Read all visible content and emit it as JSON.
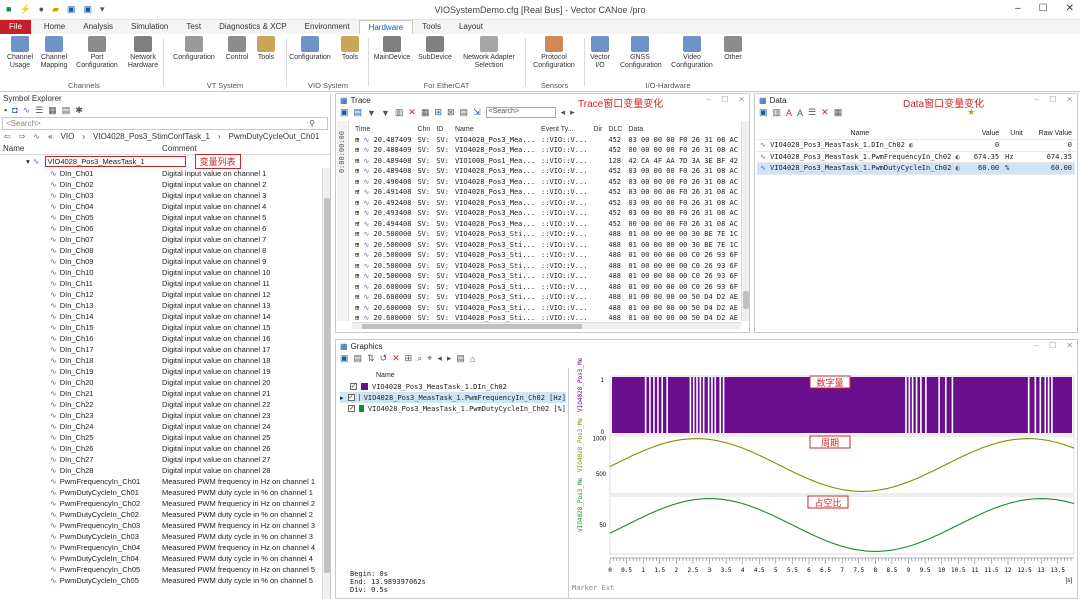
{
  "title_bar": {
    "title": "VIOSystemDemo.cfg [Real Bus] - Vector CANoe /pro"
  },
  "tabs": [
    "File",
    "Home",
    "Analysis",
    "Simulation",
    "Test",
    "Diagnostics & XCP",
    "Environment",
    "Hardware",
    "Tools",
    "Layout"
  ],
  "active_tab": "Hardware",
  "ribbon": {
    "buttons": [
      {
        "label": "Channel\nUsage",
        "icon": "channel-usage-icon"
      },
      {
        "label": "Channel\nMapping",
        "icon": "channel-mapping-icon"
      },
      {
        "label": "Port\nConfiguration",
        "icon": "port-icon"
      },
      {
        "label": "Network\nHardware",
        "icon": "network-hardware-icon"
      },
      {
        "label": "Configuration",
        "icon": "vt-config-icon"
      },
      {
        "label": "Control",
        "icon": "control-icon"
      },
      {
        "label": "Tools",
        "icon": "vt-tools-icon"
      },
      {
        "label": "Configuration",
        "icon": "vio-config-icon"
      },
      {
        "label": "Tools",
        "icon": "vio-tools-icon"
      },
      {
        "label": "MainDevice",
        "icon": "main-device-icon"
      },
      {
        "label": "SubDevice",
        "icon": "sub-device-icon"
      },
      {
        "label": "Network Adapter\nSelection",
        "icon": "network-adapter-icon"
      },
      {
        "label": "Protocol\nConfiguration",
        "icon": "protocol-icon"
      },
      {
        "label": "Vector\nI/O",
        "icon": "vector-io-icon"
      },
      {
        "label": "GNSS\nConfiguration",
        "icon": "gnss-icon"
      },
      {
        "label": "Video\nConfiguration",
        "icon": "video-icon"
      },
      {
        "label": "Other",
        "icon": "other-icon"
      }
    ],
    "groups": [
      "Channels",
      "VT System",
      "VIO System",
      "For EtherCAT",
      "Sensors",
      "I/O-Hardware"
    ]
  },
  "symbol_explorer": {
    "title": "Symbol Explorer",
    "search_placeholder": "<Search>",
    "breadcrumb": [
      "VIO",
      "VIO4028_Pos3_StimConfTask_1",
      "PwmDutyCycleOut_Ch01"
    ],
    "col_name": "Name",
    "col_comment": "Comment",
    "root": "VIO4028_Pos3_MeasTask_1",
    "root_annotation": "变量列表",
    "rows": [
      [
        "DIn_Ch01",
        "Digital input value on channel 1"
      ],
      [
        "DIn_Ch02",
        "Digital input value on channel 2"
      ],
      [
        "DIn_Ch03",
        "Digital input value on channel 3"
      ],
      [
        "DIn_Ch04",
        "Digital input value on channel 4"
      ],
      [
        "DIn_Ch05",
        "Digital input value on channel 5"
      ],
      [
        "DIn_Ch06",
        "Digital input value on channel 6"
      ],
      [
        "DIn_Ch07",
        "Digital input value on channel 7"
      ],
      [
        "DIn_Ch08",
        "Digital input value on channel 8"
      ],
      [
        "DIn_Ch09",
        "Digital input value on channel 9"
      ],
      [
        "DIn_Ch10",
        "Digital input value on channel 10"
      ],
      [
        "DIn_Ch11",
        "Digital input value on channel 11"
      ],
      [
        "DIn_Ch12",
        "Digital input value on channel 12"
      ],
      [
        "DIn_Ch13",
        "Digital input value on channel 13"
      ],
      [
        "DIn_Ch14",
        "Digital input value on channel 14"
      ],
      [
        "DIn_Ch15",
        "Digital input value on channel 15"
      ],
      [
        "DIn_Ch16",
        "Digital input value on channel 16"
      ],
      [
        "DIn_Ch17",
        "Digital input value on channel 17"
      ],
      [
        "DIn_Ch18",
        "Digital input value on channel 18"
      ],
      [
        "DIn_Ch19",
        "Digital input value on channel 19"
      ],
      [
        "DIn_Ch20",
        "Digital input value on channel 20"
      ],
      [
        "DIn_Ch21",
        "Digital input value on channel 21"
      ],
      [
        "DIn_Ch22",
        "Digital input value on channel 22"
      ],
      [
        "DIn_Ch23",
        "Digital input value on channel 23"
      ],
      [
        "DIn_Ch24",
        "Digital input value on channel 24"
      ],
      [
        "DIn_Ch25",
        "Digital input value on channel 25"
      ],
      [
        "DIn_Ch26",
        "Digital input value on channel 26"
      ],
      [
        "DIn_Ch27",
        "Digital input value on channel 27"
      ],
      [
        "DIn_Ch28",
        "Digital input value on channel 28"
      ],
      [
        "PwmFrequencyIn_Ch01",
        "Measured PWM frequency in Hz on channel 1"
      ],
      [
        "PwmDutyCycleIn_Ch01",
        "Measured PWM duty cycle in % on channel 1"
      ],
      [
        "PwmFrequencyIn_Ch02",
        "Measured PWM frequency in Hz on channel 2"
      ],
      [
        "PwmDutyCycleIn_Ch02",
        "Measured PWM duty cycle in % on channel 2"
      ],
      [
        "PwmFrequencyIn_Ch03",
        "Measured PWM frequency in Hz on channel 3"
      ],
      [
        "PwmDutyCycleIn_Ch03",
        "Measured PWM duty cycle in % on channel 3"
      ],
      [
        "PwmFrequencyIn_Ch04",
        "Measured PWM frequency in Hz on channel 4"
      ],
      [
        "PwmDutyCycleIn_Ch04",
        "Measured PWM duty cycle in % on channel 4"
      ],
      [
        "PwmFrequencyIn_Ch05",
        "Measured PWM frequency in Hz on channel 5"
      ],
      [
        "PwmDutyCycleIn_Ch05",
        "Measured PWM duty cycle in % on channel 5"
      ]
    ]
  },
  "trace": {
    "title": "Trace",
    "annotation": "Trace窗口变量变化",
    "search_placeholder": "<Search>",
    "time_marker": "0:00:00:00",
    "columns": [
      "Time",
      "Chn",
      "ID",
      "Name",
      "Event Ty...",
      "Dir",
      "DLC",
      "Data"
    ],
    "rows": [
      [
        "20.487409",
        "SV:",
        "SV:",
        "VIO4028_Pos3_Mea...",
        "::VIO::V...",
        "",
        "452",
        "03 00 00 00 F0 26 31 08 AC 2C"
      ],
      [
        "20.488409",
        "SV:",
        "SV:",
        "VIO4028_Pos3_Mea...",
        "::VIO::V...",
        "",
        "452",
        "00 00 00 00 F0 26 31 08 AC 2C"
      ],
      [
        "20.489408",
        "SV:",
        "SV:",
        "VIO1008_Pos1_Mea...",
        "::VIO::V...",
        "",
        "128",
        "42 CA 4F AA 7D 3A 3E BF 42"
      ],
      [
        "20.489408",
        "SV:",
        "SV:",
        "VIO4028_Pos3_Mea...",
        "::VIO::V...",
        "",
        "452",
        "03 00 00 00 F0 26 31 08 AC 2C"
      ],
      [
        "20.490408",
        "SV:",
        "SV:",
        "VIO4028_Pos3_Mea...",
        "::VIO::V...",
        "",
        "452",
        "03 00 00 00 F0 26 31 08 AC 2C"
      ],
      [
        "20.491408",
        "SV:",
        "SV:",
        "VIO4028_Pos3_Mea...",
        "::VIO::V...",
        "",
        "452",
        "03 00 00 00 F0 26 31 08 AC 2C"
      ],
      [
        "20.492408",
        "SV:",
        "SV:",
        "VIO4028_Pos3_Mea...",
        "::VIO::V...",
        "",
        "452",
        "03 00 00 00 F0 26 31 08 AC 2C"
      ],
      [
        "20.493408",
        "SV:",
        "SV:",
        "VIO4028_Pos3_Mea...",
        "::VIO::V...",
        "",
        "452",
        "03 00 00 00 F0 26 31 08 AC 2C"
      ],
      [
        "20.494408",
        "SV:",
        "SV:",
        "VIO4028_Pos3_Mea...",
        "::VIO::V...",
        "",
        "452",
        "00 00 00 00 F0 26 31 08 AC 2C"
      ],
      [
        "20.500000",
        "SV:",
        "SV:",
        "VIO4028_Pos3_Sti...",
        "::VIO::V...",
        "",
        "488",
        "01 00 00 00 00 30 BE 7E 1C"
      ],
      [
        "20.500000",
        "SV:",
        "SV:",
        "VIO4028_Pos3_Sti...",
        "::VIO::V...",
        "",
        "488",
        "01 00 00 00 00 30 BE 7E 1C"
      ],
      [
        "20.500000",
        "SV:",
        "SV:",
        "VIO4028_Pos3_Sti...",
        "::VIO::V...",
        "",
        "488",
        "01 00 00 00 00 C0 26 93 6F"
      ],
      [
        "20.500000",
        "SV:",
        "SV:",
        "VIO4028_Pos3_Sti...",
        "::VIO::V...",
        "",
        "488",
        "01 00 00 00 00 C0 26 93 6F"
      ],
      [
        "20.500000",
        "SV:",
        "SV:",
        "VIO4028_Pos3_Sti...",
        "::VIO::V...",
        "",
        "488",
        "01 00 00 00 00 C0 26 93 6F"
      ],
      [
        "20.600000",
        "SV:",
        "SV:",
        "VIO4028_Pos3_Sti...",
        "::VIO::V...",
        "",
        "488",
        "01 00 00 00 00 C0 26 93 6F"
      ],
      [
        "20.600000",
        "SV:",
        "SV:",
        "VIO4028_Pos3_Sti...",
        "::VIO::V...",
        "",
        "488",
        "01 00 00 00 00 50 D4 D2 AE"
      ],
      [
        "20.600000",
        "SV:",
        "SV:",
        "VIO4028_Pos3_Sti...",
        "::VIO::V...",
        "",
        "488",
        "01 00 00 00 00 50 D4 D2 AE"
      ],
      [
        "20.600000",
        "SV:",
        "SV:",
        "VIO4028_Pos3_Sti...",
        "::VIO::V...",
        "",
        "488",
        "01 00 00 00 00 50 D4 D2 AE"
      ]
    ]
  },
  "data_window": {
    "title": "Data",
    "annotation": "Data窗口变量变化",
    "columns": [
      "Name",
      "Value",
      "Unit",
      "Raw Value"
    ],
    "rows": [
      [
        "VIO4028_Pos3_MeasTask_1.DIn_Ch02",
        "0",
        "",
        "0"
      ],
      [
        "VIO4028_Pos3_MeasTask_1.PwmFrequencyIn_Ch02",
        "674.35",
        "Hz",
        "674.35"
      ],
      [
        "VIO4028_Pos3_MeasTask_1.PwmDutyCycleIn_Ch02",
        "60.00",
        "%",
        "60.00"
      ]
    ]
  },
  "graphics": {
    "title": "Graphics",
    "legend_header": "Name",
    "signals": [
      {
        "name": "VIO4028_Pos3_MeasTask_1.DIn_Ch02",
        "color": "#6a0f8e"
      },
      {
        "name": "VIO4028_Pos3_MeasTask_1.PwmFrequencyIn_Ch02 [Hz]",
        "color": "#8a8a00"
      },
      {
        "name": "VIO4028_Pos3_MeasTask_1.PwmDutyCycleIn_Ch02 [%]",
        "color": "#1a8a2a"
      }
    ],
    "begin": "Begin: 0s",
    "end": "End: 13.989397062s",
    "div": "Div: 0.5s",
    "marker": "Marker Ext",
    "axis_labels": [
      "VIO4028_Pos3_Me",
      "VIO4028_Pos3_Me",
      "VIO4028_Pos3_Me"
    ],
    "annotations": [
      "数字量",
      "周期",
      "占空比"
    ],
    "x_ticks": [
      "0",
      "0.5",
      "1",
      "1.5",
      "2",
      "2.5",
      "3",
      "3.5",
      "4",
      "4.5",
      "5",
      "5.5",
      "6",
      "6.5",
      "7",
      "7.5",
      "8",
      "8.5",
      "9",
      "9.5",
      "10",
      "10.5",
      "11",
      "11.5",
      "12",
      "12.5",
      "13",
      "13.5"
    ],
    "x_unit": "[s]",
    "chart_data": {
      "type": "line",
      "series": [
        {
          "name": "VIO4028_Pos3_MeasTask_1.DIn_Ch02",
          "y_ticks": [
            "1",
            "0"
          ]
        },
        {
          "name": "VIO4028_Pos3_MeasTask_1.PwmFrequencyIn_Ch02 [Hz]",
          "y_ticks": [
            "1000",
            "500"
          ],
          "shape": "sine",
          "min": 250,
          "max": 1000,
          "period_s": 10,
          "peak_s": 2.6
        },
        {
          "name": "VIO4028_Pos3_MeasTask_1.PwmDutyCycleIn_Ch02 [%]",
          "y_ticks": [
            "50"
          ],
          "shape": "sine",
          "min": 10,
          "max": 90,
          "period_s": 10,
          "peak_s": 13.0
        }
      ],
      "xlim": [
        0,
        13.99
      ]
    }
  }
}
